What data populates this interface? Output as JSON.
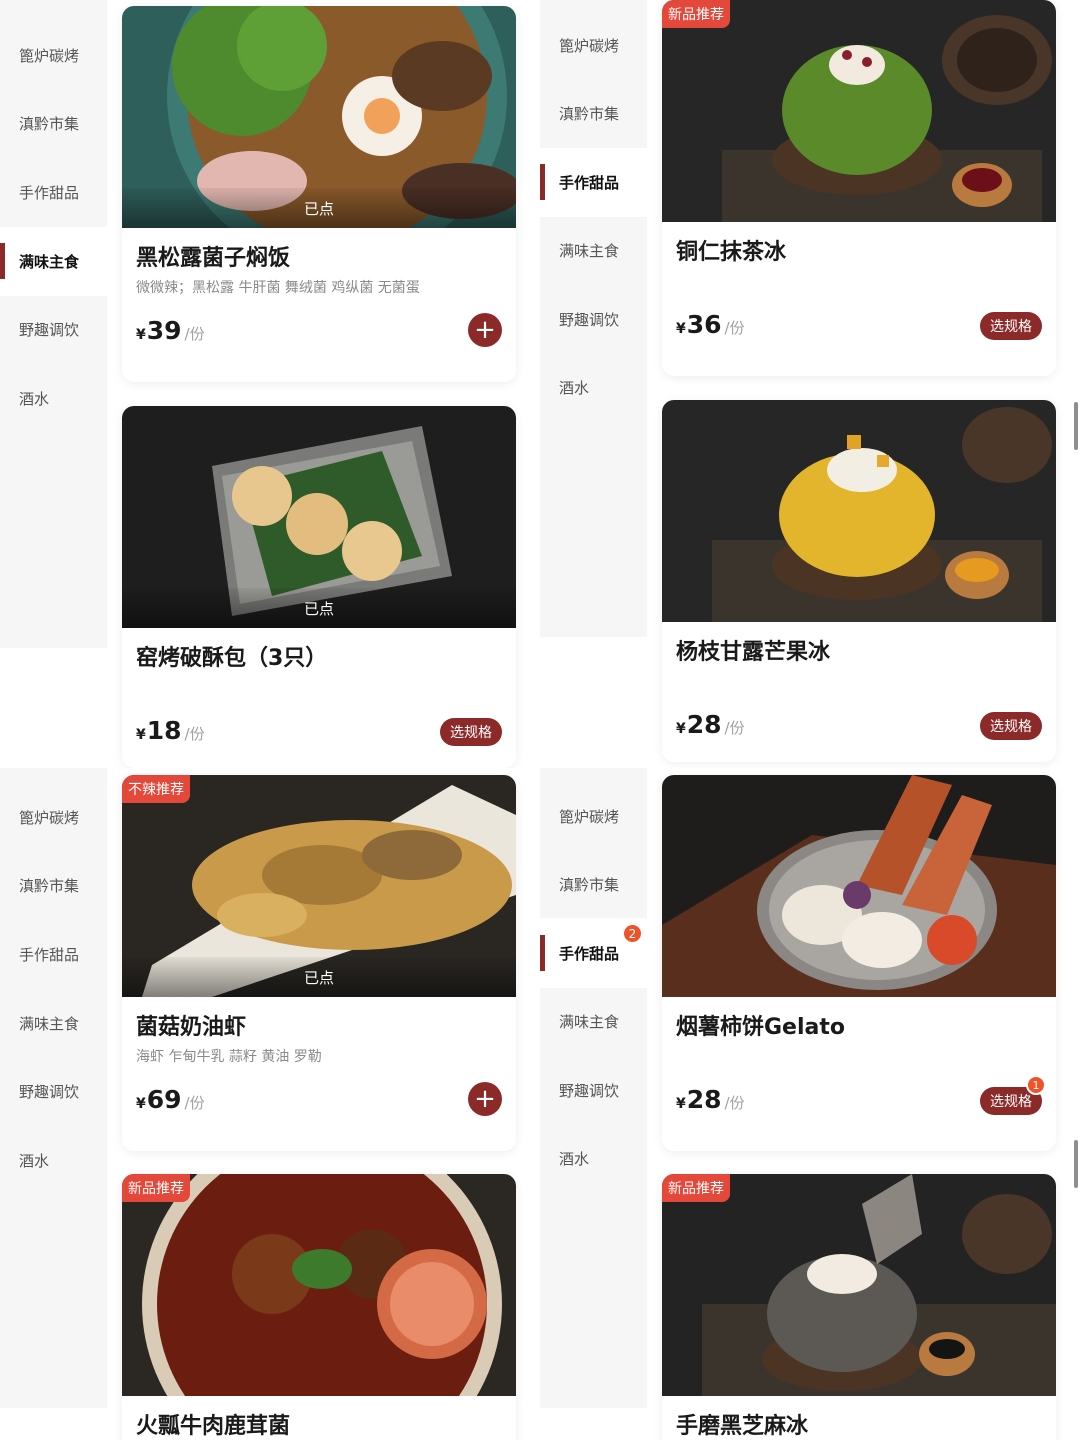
{
  "panel1": {
    "nav": [
      "篦炉碳烤",
      "滇黔市集",
      "手作甜品",
      "满味主食",
      "野趣调饮",
      "酒水"
    ],
    "cards": [
      {
        "name": "黑松露菌子焖饭",
        "desc": "微微辣；黑松露 牛肝菌 舞绒菌 鸡纵菌 无菌蛋",
        "price": "39",
        "ordered": "已点"
      },
      {
        "name": "窑烤破酥包（3只）",
        "price": "18",
        "ordered": "已点",
        "spec": "选规格"
      }
    ]
  },
  "panel2": {
    "nav": [
      "篦炉碳烤",
      "滇黔市集",
      "手作甜品",
      "满味主食",
      "野趣调饮",
      "酒水"
    ],
    "cards": [
      {
        "name": "铜仁抹茶冰",
        "price": "36",
        "tag": "新品推荐",
        "spec": "选规格"
      },
      {
        "name": "杨枝甘露芒果冰",
        "price": "28",
        "spec": "选规格"
      }
    ]
  },
  "panel3": {
    "nav": [
      "篦炉碳烤",
      "滇黔市集",
      "手作甜品",
      "满味主食",
      "野趣调饮",
      "酒水"
    ],
    "cards": [
      {
        "name": "菌菇奶油虾",
        "desc": "海虾 乍甸牛乳 蒜籽 黄油 罗勒",
        "price": "69",
        "tag": "不辣推荐",
        "ordered": "已点"
      },
      {
        "name": "火瓢牛肉鹿茸菌",
        "tag": "新品推荐"
      }
    ]
  },
  "panel4": {
    "nav": [
      "篦炉碳烤",
      "滇黔市集",
      "手作甜品",
      "满味主食",
      "野趣调饮",
      "酒水"
    ],
    "nav_badge": "2",
    "cards": [
      {
        "name": "烟薯柿饼Gelato",
        "price": "28",
        "spec": "选规格",
        "spec_badge": "1"
      },
      {
        "name": "手磨黑芝麻冰",
        "tag": "新品推荐"
      }
    ]
  },
  "common": {
    "currency": "¥",
    "unit": "/份",
    "add_icon": "plus-icon"
  },
  "colors": {
    "accent": "#8c2a2a",
    "tag": "#e4483a",
    "badge": "#f0522a",
    "sidebar_bg": "#f6f6f6"
  }
}
